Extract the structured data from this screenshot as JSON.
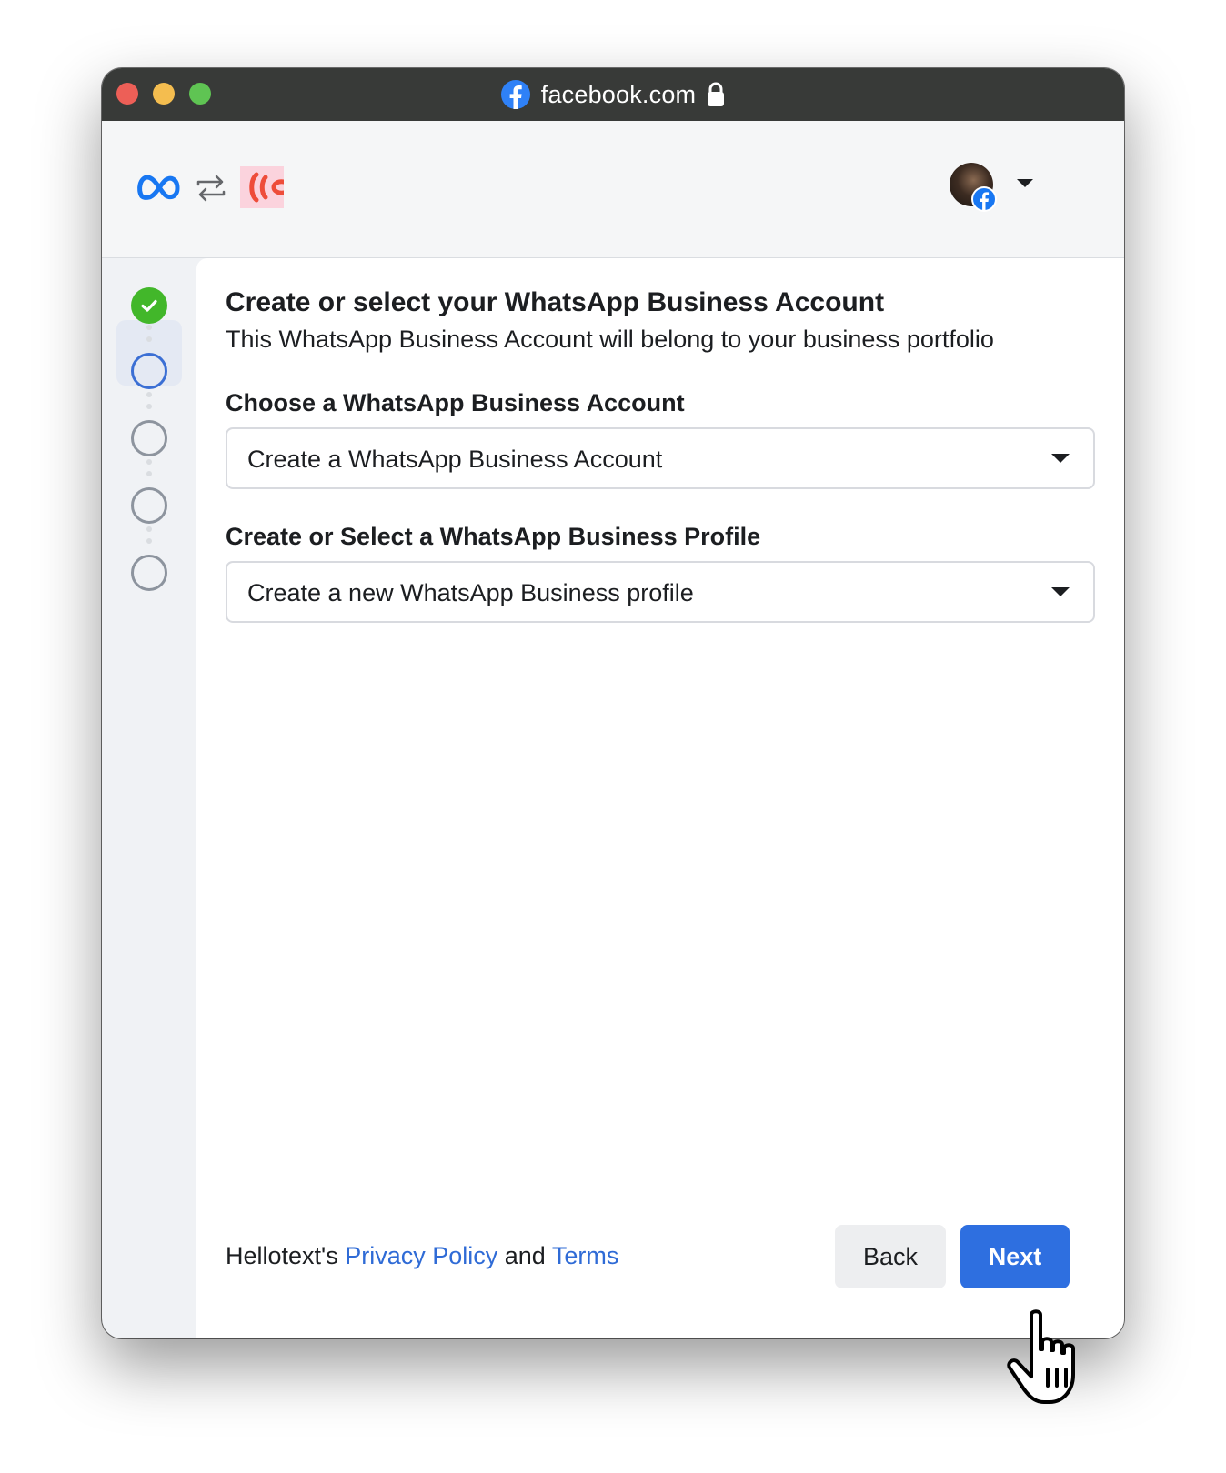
{
  "browser": {
    "url": "facebook.com"
  },
  "dialog": {
    "title": "Create or select your WhatsApp Business Account",
    "subtitle": "This WhatsApp Business Account will belong to your business portfolio",
    "account_field": {
      "label": "Choose a WhatsApp Business Account",
      "value": "Create a WhatsApp Business Account"
    },
    "profile_field": {
      "label": "Create or Select a WhatsApp Business Profile",
      "value": "Create a new WhatsApp Business profile"
    },
    "steps": [
      {
        "state": "done"
      },
      {
        "state": "active"
      },
      {
        "state": "pending"
      },
      {
        "state": "pending"
      },
      {
        "state": "pending"
      }
    ]
  },
  "footer": {
    "prefix": "Hellotext's ",
    "privacy_link": "Privacy Policy",
    "conjunction": " and ",
    "terms_link": "Terms",
    "back_label": "Back",
    "next_label": "Next"
  },
  "colors": {
    "primary_blue": "#2e6fe0",
    "link_blue": "#2f6bd6",
    "step_done_green": "#42b72a",
    "step_active_blue": "#3b6fd4"
  },
  "icons": {
    "url_favicon": "facebook-icon",
    "url_secure": "lock-icon",
    "brand": "meta-logo-icon",
    "swap": "swap-arrows-icon",
    "partner": "hellotext-logo-icon",
    "account_badge": "facebook-badge-icon",
    "dropdown": "caret-down-icon",
    "cursor": "hand-pointer-icon"
  }
}
